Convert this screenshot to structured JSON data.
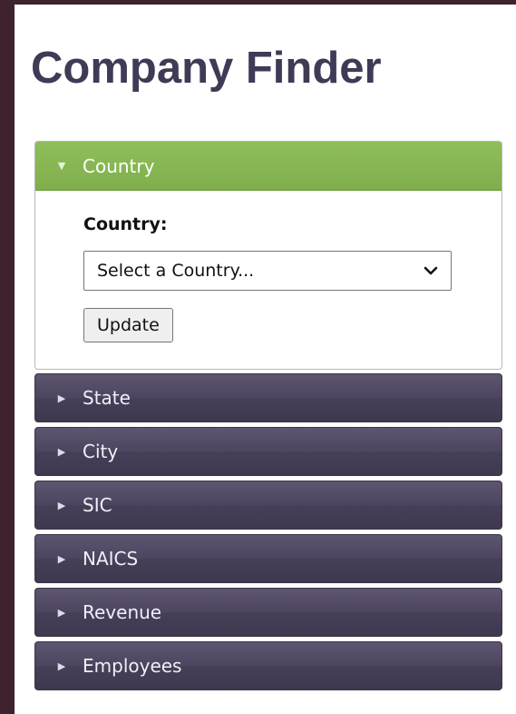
{
  "header": {
    "title": "Company Finder"
  },
  "accordion": {
    "open_section": {
      "label": "Country",
      "field_label": "Country:",
      "select_value": "Select a Country...",
      "button_label": "Update"
    },
    "sections": [
      {
        "label": "State"
      },
      {
        "label": "City"
      },
      {
        "label": "SIC"
      },
      {
        "label": "NAICS"
      },
      {
        "label": "Revenue"
      },
      {
        "label": "Employees"
      }
    ]
  },
  "icons": {
    "expanded": "triangle-down-icon",
    "collapsed": "triangle-right-icon",
    "select": "chevron-down-icon"
  },
  "colors": {
    "background": "#3e2230",
    "title": "#3f3a55",
    "active_header": "#86b654",
    "inactive_header": "#4d4560"
  }
}
